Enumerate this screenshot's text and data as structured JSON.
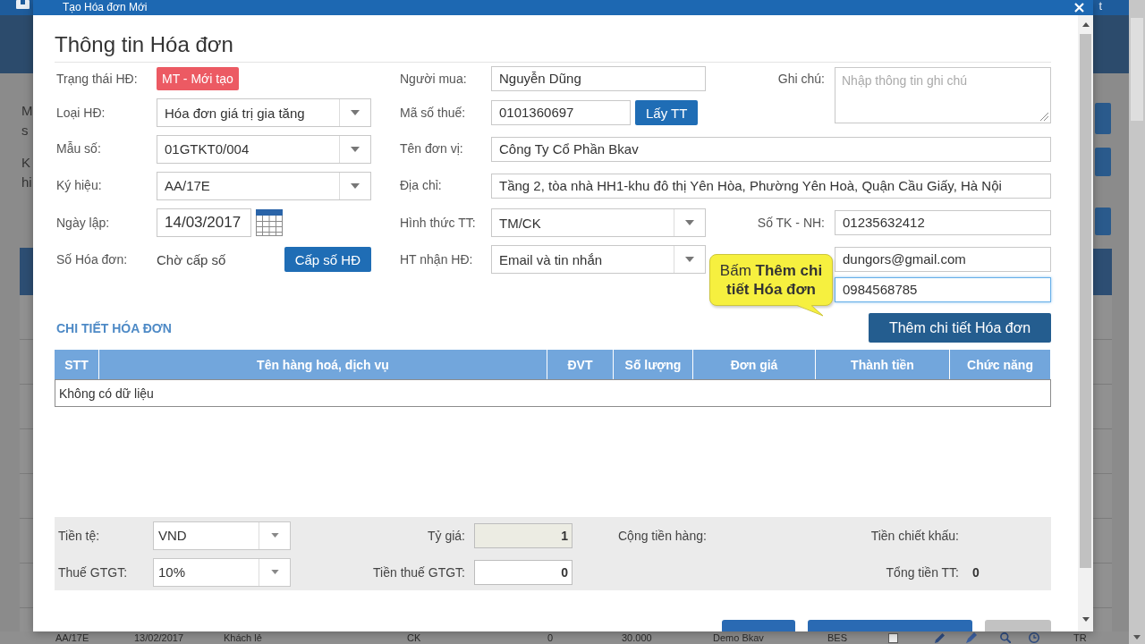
{
  "page": {
    "header_text": "t",
    "side_texts": [
      "M",
      "s",
      "K",
      "hi"
    ],
    "bottom_row": {
      "cells": [
        "AA/17E",
        "13/02/2017",
        "Khách lẻ",
        "CK",
        "0",
        "30.000",
        "Demo Bkav",
        "BES"
      ],
      "checked": false,
      "end_text": "TR"
    }
  },
  "dialog": {
    "title": "Tạo Hóa đơn Mới",
    "heading": "Thông tin Hóa đơn",
    "fields": [
      {
        "label": "Trạng thái HĐ:",
        "kind": "badge",
        "value": "MT - Mới tạo",
        "focused": false
      },
      {
        "label": "Người mua:",
        "kind": "input",
        "value": "Nguyễn Dũng",
        "focused": false
      },
      {
        "label": "Ghi chú:",
        "kind": "textarea",
        "placeholder": "Nhập thông tin ghi chú",
        "focused": false
      },
      {
        "label": "Loại HĐ:",
        "kind": "select",
        "value": "Hóa đơn giá trị gia tăng",
        "focused": false
      },
      {
        "label": "Mã số thuế:",
        "kind": "input",
        "value": "0101360697",
        "button": "Lấy TT",
        "focused": false
      },
      {
        "label": "Mẫu số:",
        "kind": "select",
        "value": "01GTKT0/004",
        "focused": false
      },
      {
        "label": "Tên đơn vị:",
        "kind": "input",
        "value": "Công Ty Cổ Phần Bkav",
        "focused": false
      },
      {
        "label": "Ký hiệu:",
        "kind": "select",
        "value": "AA/17E",
        "focused": false
      },
      {
        "label": "Địa chỉ:",
        "kind": "input",
        "value": "Tầng 2, tòa nhà HH1-khu đô thị Yên Hòa, Phường Yên Hoà, Quận Cầu Giấy, Hà Nội",
        "focused": false
      },
      {
        "label": "Ngày lập:",
        "kind": "date",
        "value": "14/03/2017",
        "focused": false
      },
      {
        "label": "Hình thức TT:",
        "kind": "select",
        "value": "TM/CK",
        "focused": false
      },
      {
        "label": "Số TK - NH:",
        "kind": "input",
        "value": "01235632412",
        "focused": false
      },
      {
        "label": "Số Hóa đơn:",
        "kind": "text",
        "value": "Chờ cấp số",
        "button": "Cấp số HĐ",
        "focused": false
      },
      {
        "label": "HT nhận HĐ:",
        "kind": "select",
        "value": "Email và tin nhắn",
        "focused": false
      },
      {
        "kind": "input",
        "value": "dungors@gmail.com",
        "focused": false
      },
      {
        "kind": "input",
        "value": "0984568785",
        "focused": true
      }
    ],
    "tooltip": "Bấm **Thêm chi tiết Hóa đơn**",
    "details": {
      "title": "CHI TIẾT HÓA ĐƠN",
      "add_button": "Thêm chi tiết Hóa đơn",
      "columns": [
        "STT",
        "Tên hàng hoá, dịch vụ",
        "ĐVT",
        "Số lượng",
        "Đơn giá",
        "Thành tiền",
        "Chức năng"
      ],
      "empty_message": "Không có dữ liệu"
    },
    "summary": [
      {
        "label": "Tiền tệ:",
        "kind": "select",
        "value": "VND"
      },
      {
        "label": "Tỷ giá:",
        "kind": "readonly",
        "value": "1"
      },
      {
        "label": "Cộng tiền hàng:",
        "kind": "total"
      },
      {
        "label": "Tiền chiết khấu:",
        "kind": "total"
      },
      {
        "label": "Thuế GTGT:",
        "kind": "select",
        "value": "10%"
      },
      {
        "label": "Tiền thuế GTGT:",
        "kind": "input",
        "value": "0"
      },
      {
        "label": "Tổng tiền TT:",
        "kind": "total",
        "value": "0"
      }
    ],
    "footer_buttons": [
      {
        "kind": "primary"
      },
      {
        "kind": "primary"
      },
      {
        "kind": "secondary"
      }
    ]
  }
}
